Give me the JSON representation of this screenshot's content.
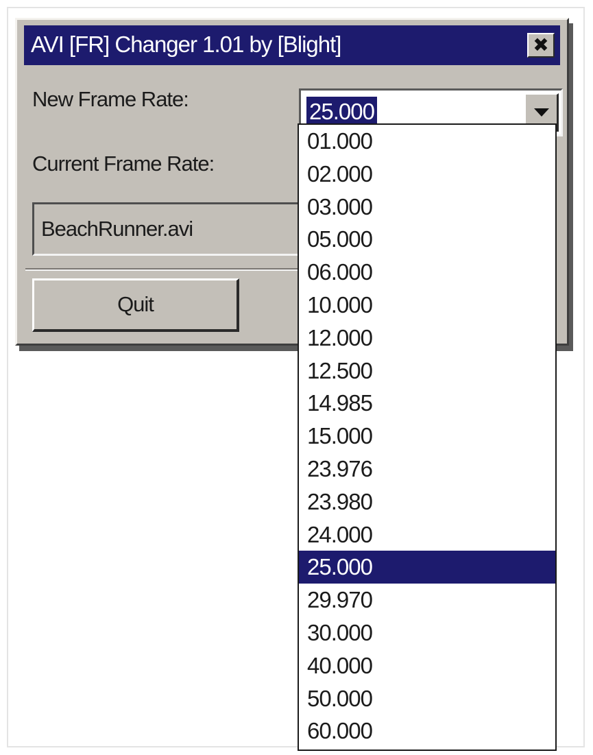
{
  "window": {
    "title": "AVI [FR] Changer 1.01 by [Blight]",
    "close_glyph": "✖"
  },
  "form": {
    "new_frame_rate_label": "New Frame Rate:",
    "new_frame_rate_value": "25.000",
    "current_frame_rate_label": "Current Frame Rate:",
    "file_name": "BeachRunner.avi",
    "quit_label": "Quit"
  },
  "dropdown": {
    "selected": "25.000",
    "options": [
      "01.000",
      "02.000",
      "03.000",
      "05.000",
      "06.000",
      "10.000",
      "12.000",
      "12.500",
      "14.985",
      "15.000",
      "23.976",
      "23.980",
      "24.000",
      "25.000",
      "29.970",
      "30.000",
      "40.000",
      "50.000",
      "60.000"
    ]
  },
  "colors": {
    "titlebar": "#1d1b6e",
    "selection": "#1d1b6e",
    "window_face": "#c3bfb8"
  },
  "icons": {
    "close": "close-icon",
    "dropdown_arrow": "chevron-down-icon"
  }
}
